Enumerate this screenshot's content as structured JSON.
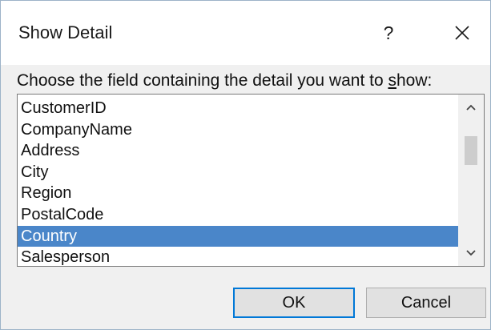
{
  "dialog": {
    "title": "Show Detail",
    "help_label": "?",
    "close_icon": "close-icon",
    "prompt_before": "Choose the field containing the detail you want to ",
    "prompt_accel": "s",
    "prompt_after": "how:",
    "list": {
      "items": [
        "CustomerID",
        "CompanyName",
        "Address",
        "City",
        "Region",
        "PostalCode",
        "Country",
        "Salesperson"
      ],
      "selected_item": "Country",
      "scroll_position": 0.15
    },
    "buttons": {
      "ok_label": "OK",
      "cancel_label": "Cancel"
    }
  },
  "colors": {
    "selection": "#4a86c9",
    "default_button_border": "#0078d7"
  }
}
